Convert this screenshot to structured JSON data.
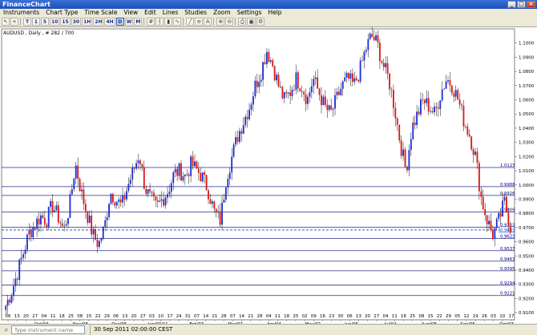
{
  "window": {
    "title": "FinanceChart"
  },
  "menu": [
    "Instruments",
    "Chart Type",
    "Time Scale",
    "View",
    "Edit",
    "Lines",
    "Studies",
    "Zoom",
    "Settings",
    "Help"
  ],
  "toolbar": {
    "timeframes": [
      "T",
      "1",
      "5",
      "10",
      "15",
      "30",
      "1H",
      "2H",
      "4H",
      "D",
      "W",
      "M"
    ],
    "selected_timeframe": "D",
    "icons": [
      "pointer-icon",
      "crosshair-icon",
      "hash-icon",
      "bar-chart-icon",
      "candlestick-icon",
      "line-chart-icon",
      "trendline-icon",
      "fibonacci-icon",
      "text-icon",
      "zoom-in-icon",
      "zoom-out-icon",
      "print-icon",
      "save-icon",
      "settings-icon"
    ]
  },
  "chart": {
    "header": "AUDUSD , Daily , # 282 / 700",
    "close_price": "0.9683",
    "chart_data": {
      "type": "candlestick",
      "instrument": "AUDUSD",
      "timeframe": "Daily",
      "ylim": [
        0.905,
        1.11
      ],
      "y_ticks": [
        "1.1000",
        "1.0900",
        "1.0800",
        "1.0700",
        "1.0600",
        "1.0500",
        "1.0400",
        "1.0300",
        "1.0200",
        "1.0100",
        "1.0000",
        "0.9900",
        "0.9800",
        "0.9700",
        "0.9600",
        "0.9500",
        "0.9400",
        "0.9300",
        "0.9200",
        "0.9100"
      ],
      "horizontal_levels": [
        "1.0123",
        "0.9988",
        "0.9926",
        "0.9809",
        "0.9703",
        "0.9623",
        "0.9537",
        "0.9463",
        "0.9395",
        "0.9294",
        "0.9221"
      ],
      "current_price": "0.9683",
      "x_day_labels": [
        "06",
        "13",
        "20",
        "27",
        "04",
        "11",
        "18",
        "25",
        "08",
        "15",
        "22",
        "29",
        "06",
        "13",
        "20",
        "27",
        "03",
        "10",
        "17",
        "24",
        "31",
        "07",
        "14",
        "21",
        "28",
        "07",
        "14",
        "21",
        "28",
        "04",
        "11",
        "18",
        "25",
        "02",
        "09",
        "16",
        "23",
        "30",
        "06",
        "13",
        "20",
        "27",
        "04",
        "11",
        "18",
        "25",
        "08",
        "15",
        "22",
        "29",
        "05",
        "12",
        "19",
        "26",
        "03",
        "10",
        "17"
      ],
      "x_month_labels": [
        "Oct/04",
        "Nov/08",
        "Dec/06",
        "Jan/03/11",
        "Feb/07",
        "Mar/07",
        "Apr/04",
        "May/02",
        "Jun/06",
        "Jul/04",
        "Aug/08",
        "Sep/05",
        "Oct/03"
      ],
      "close_path": [
        0.915,
        0.925,
        0.938,
        0.952,
        0.966,
        0.972,
        0.978,
        0.975,
        0.986,
        0.978,
        0.968,
        0.985,
        1.015,
        0.995,
        0.98,
        0.965,
        0.958,
        0.97,
        0.995,
        0.99,
        0.985,
        0.999,
        1.01,
        1.022,
        0.998,
        0.99,
        0.984,
        0.99,
        0.996,
        1.008,
        1.01,
        1.006,
        1.015,
        1.01,
        1.005,
        0.995,
        0.98,
        0.975,
        1.005,
        1.02,
        1.035,
        1.045,
        1.055,
        1.07,
        1.08,
        1.095,
        1.085,
        1.07,
        1.06,
        1.065,
        1.075,
        1.07,
        1.06,
        1.075,
        1.065,
        1.055,
        1.05,
        1.06,
        1.07,
        1.075,
        1.07,
        1.08,
        1.095,
        1.105,
        1.1,
        1.085,
        1.075,
        1.055,
        1.03,
        1.01,
        1.04,
        1.05,
        1.06,
        1.055,
        1.05,
        1.065,
        1.075,
        1.07,
        1.06,
        1.045,
        1.035,
        1.02,
        0.99,
        0.975,
        0.965,
        0.975,
        0.988,
        0.97
      ]
    }
  },
  "status": {
    "search_placeholder": "Type instrument name",
    "datetime": "30 Sep 2011 02:00:00 CEST"
  }
}
